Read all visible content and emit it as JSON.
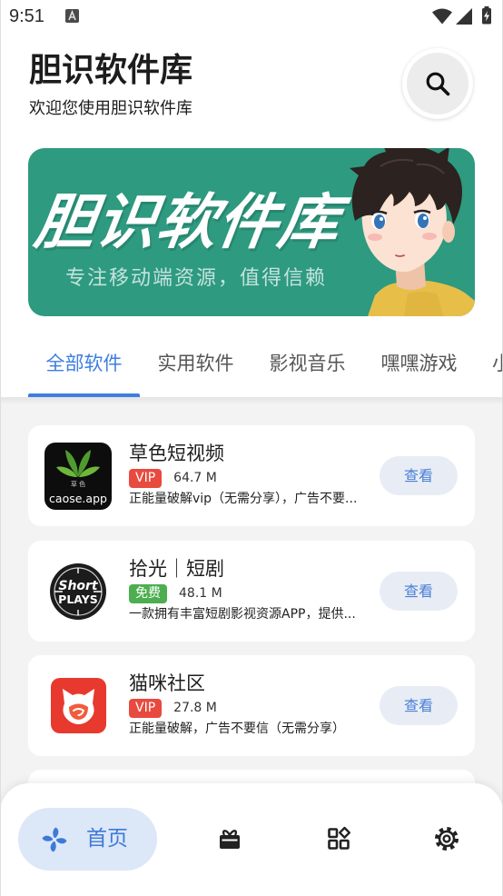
{
  "status_bar": {
    "time": "9:51",
    "icons": [
      "a-notification-icon",
      "wifi-icon",
      "signal-icon",
      "battery-charging-icon"
    ]
  },
  "header": {
    "title": "胆识软件库",
    "subtitle": "欢迎您使用胆识软件库",
    "search_icon": "search-icon"
  },
  "banner": {
    "title": "胆识软件库",
    "tagline": "专注移动端资源，值得信赖",
    "background_color": "#2e9a80"
  },
  "tabs": {
    "items": [
      {
        "label": "全部软件",
        "active": true
      },
      {
        "label": "实用软件",
        "active": false
      },
      {
        "label": "影视音乐",
        "active": false
      },
      {
        "label": "嘿嘿游戏",
        "active": false
      },
      {
        "label": "小",
        "active": false
      }
    ],
    "active_color": "#3d7ee0",
    "inactive_color": "#555555"
  },
  "apps": [
    {
      "name": "草色短视频",
      "badge": "VIP",
      "badge_color": "#e84a3f",
      "size": "64.7 M",
      "description": "正能量破解vip（无需分享），广告不要...",
      "action": "查看",
      "icon": "caose-app-icon",
      "icon_text": [
        "草 色",
        "caose.app"
      ]
    },
    {
      "name": "拾光｜短剧",
      "badge": "免费",
      "badge_color": "#4cae4f",
      "size": "48.1 M",
      "description": "一款拥有丰富短剧影视资源APP，提供...",
      "action": "查看",
      "icon": "short-plays-app-icon",
      "icon_text": [
        "Short",
        "PLAYS"
      ]
    },
    {
      "name": "猫咪社区",
      "badge": "VIP",
      "badge_color": "#e84a3f",
      "size": "27.8 M",
      "description": "正能量破解，广告不要信（无需分享）",
      "action": "查看",
      "icon": "cat-community-app-icon"
    }
  ],
  "bottom_nav": {
    "items": [
      {
        "label": "首页",
        "icon": "pinwheel-icon",
        "active": true
      },
      {
        "icon": "gift-icon",
        "active": false
      },
      {
        "icon": "apps-grid-icon",
        "active": false
      },
      {
        "icon": "settings-gear-icon",
        "active": false
      }
    ],
    "active_color": "#3d7ad8",
    "active_bg": "#dce7f8"
  }
}
